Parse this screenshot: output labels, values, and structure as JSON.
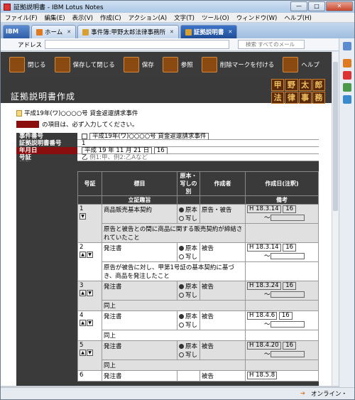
{
  "window": {
    "title": "証拠説明書 - IBM Lotus Notes",
    "minimize": "—",
    "maximize": "□",
    "close": "✕"
  },
  "menu": [
    "ファイル(F)",
    "編集(E)",
    "表示(V)",
    "作成(C)",
    "アクション(A)",
    "文字(T)",
    "ツール(O)",
    "ウィンドウ(W)",
    "ヘルプ(H)"
  ],
  "tabs": {
    "launcher": "IBM",
    "home": "ホーム",
    "case": "事件簿:甲野太郎法律事務所",
    "doc": "証拠説明書"
  },
  "address": {
    "label": "アドレス",
    "search_placeholder": "検索 すべてのメール"
  },
  "toolbar": {
    "close": "閉じる",
    "save_close": "保存して閉じる",
    "save": "保存",
    "ref": "参照",
    "delete_mark": "削除マークを付ける",
    "help": "ヘルプ"
  },
  "page": {
    "title": "証拠説明書作成",
    "case": "平成19年(ワ)○○○○号 貸金返還請求事件",
    "required_note": "の項目は、必ず入力してください。"
  },
  "logo": [
    "甲",
    "野",
    "太",
    "郎",
    "法",
    "律",
    "事",
    "務",
    "所"
  ],
  "form": {
    "case_no_label": "事件番号",
    "case_no_value": "平成19年(ワ)○○○○号 貸金返還請求事件",
    "doc_no_label": "証拠説明書番号",
    "doc_no_value": "1",
    "date_label": "年月日",
    "date_value": "平成 19 年 11 月 21 日",
    "date_btn": "16",
    "evidence_label": "号証",
    "evidence_value": "乙",
    "evidence_hint": "例1:甲、例2:乙Aなど",
    "evidence_header": "証拠"
  },
  "table": {
    "headers": {
      "no": "号証",
      "title": "標目",
      "orig": "原本・写しの別",
      "author": "作成者",
      "date": "作成日(注釈)",
      "purpose": "立証趣旨",
      "note": "備考"
    },
    "radio": {
      "orig": "原本",
      "copy": "写し"
    },
    "rows": [
      {
        "no": "1",
        "title": "商品販売基本契約",
        "author": "原告・被告",
        "date": "H 18.3.14",
        "purpose": "原告と被告との間に商品に関する販売契約が締結されていたこと"
      },
      {
        "no": "2",
        "title": "発注書",
        "author": "被告",
        "date": "H 18.3.14",
        "purpose": "原告が被告に対し、甲第1号証の基本契約に基づき、商品を発注したこと"
      },
      {
        "no": "3",
        "title": "発注書",
        "author": "被告",
        "date": "H 18.3.24",
        "purpose": "同上"
      },
      {
        "no": "4",
        "title": "発注書",
        "author": "被告",
        "date": "H 18.4.6",
        "purpose": "同上"
      },
      {
        "no": "5",
        "title": "発注書",
        "author": "被告",
        "date": "H 18.4.20",
        "purpose": "同上"
      },
      {
        "no": "6",
        "title": "発注書",
        "author": "被告",
        "date": "H 18.5.8",
        "purpose": ""
      }
    ],
    "cal": "16",
    "tilde": "〜"
  },
  "status": {
    "online": "オンライン・"
  }
}
